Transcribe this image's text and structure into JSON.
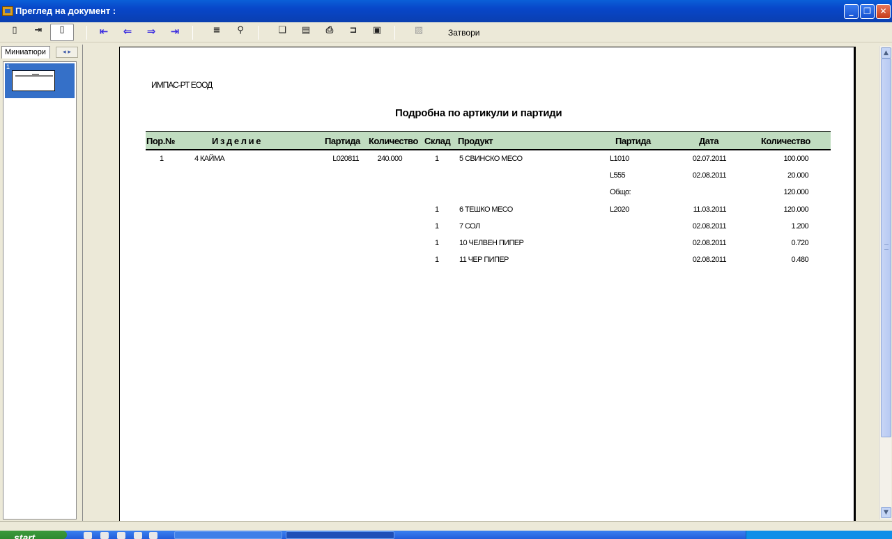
{
  "window": {
    "title": "Преглед на документ :"
  },
  "toolbar": {
    "close_label": "Затвори"
  },
  "panel": {
    "tab_label": "Миниатюри",
    "thumb_number": "1"
  },
  "report": {
    "company": "ИМПАС-РТ ЕООД",
    "title": "Подробна по артикули и партиди",
    "headers": {
      "no": "Пор.№",
      "product": "И з д е л и е",
      "batch": "Партида",
      "qty": "Количество",
      "store": "Склад",
      "ingredient": "Продукт",
      "batch2": "Партида",
      "date": "Дата",
      "qty2": "Количество"
    },
    "rows": [
      {
        "no": "1",
        "product": "4 КАЙМА",
        "batch": "L020811",
        "qty": "240.000",
        "store": "1",
        "ingredient": "5 СВИНСКО МЕСО",
        "batch2": "L1010",
        "date": "02.07.2011",
        "qty2": "100.000"
      },
      {
        "no": "",
        "product": "",
        "batch": "",
        "qty": "",
        "store": "",
        "ingredient": "",
        "batch2": "L555",
        "date": "02.08.2011",
        "qty2": "20.000"
      },
      {
        "no": "",
        "product": "",
        "batch": "",
        "qty": "",
        "store": "",
        "ingredient": "",
        "batch2": "Общо:",
        "date": "",
        "qty2": "120.000"
      },
      {
        "no": "",
        "product": "",
        "batch": "",
        "qty": "",
        "store": "1",
        "ingredient": "6 ТЕШКО МЕСО",
        "batch2": "L2020",
        "date": "11.03.2011",
        "qty2": "120.000"
      },
      {
        "no": "",
        "product": "",
        "batch": "",
        "qty": "",
        "store": "1",
        "ingredient": "7 СОЛ",
        "batch2": "",
        "date": "02.08.2011",
        "qty2": "1.200"
      },
      {
        "no": "",
        "product": "",
        "batch": "",
        "qty": "",
        "store": "1",
        "ingredient": "10 ЧЕЛВЕН ПИПЕР",
        "batch2": "",
        "date": "02.08.2011",
        "qty2": "0.720"
      },
      {
        "no": "",
        "product": "",
        "batch": "",
        "qty": "",
        "store": "1",
        "ingredient": "11 ЧЕР ПИПЕР",
        "batch2": "",
        "date": "02.08.2011",
        "qty2": "0.480"
      }
    ]
  },
  "taskbar": {
    "start_label": "start"
  }
}
